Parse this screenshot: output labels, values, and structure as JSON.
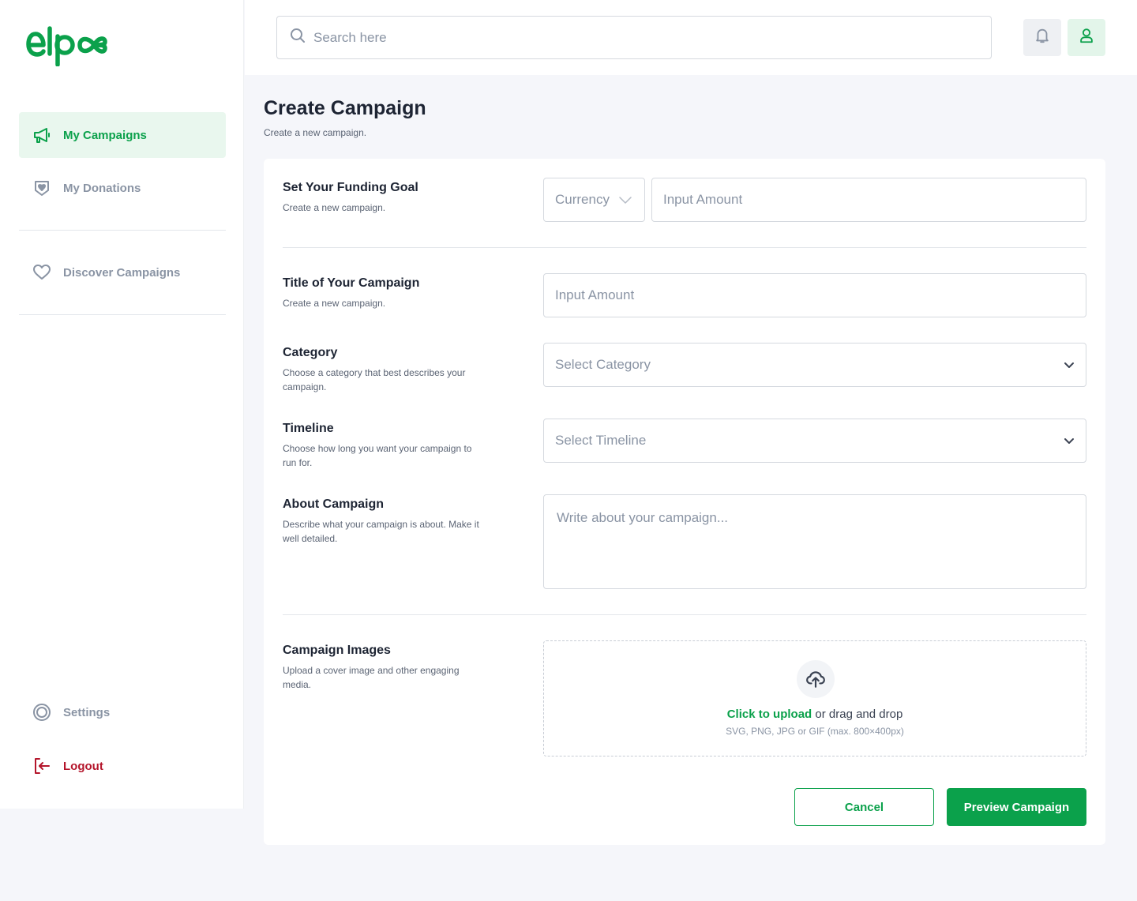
{
  "brand": {
    "logo_text": "elp",
    "accent": "#0BA14B",
    "danger": "#B4152B"
  },
  "header": {
    "search_placeholder": "Search here",
    "icons": [
      "search-icon",
      "bell-icon",
      "user-icon"
    ]
  },
  "sidebar": {
    "items": [
      {
        "label": "My Campaigns",
        "icon": "megaphone-icon",
        "active": true
      },
      {
        "label": "My Donations",
        "icon": "donation-icon",
        "active": false
      },
      {
        "label": "Discover Campaigns",
        "icon": "heart-icon",
        "active": false
      }
    ],
    "settings_label": "Settings",
    "logout_label": "Logout"
  },
  "page": {
    "title": "Create Campaign",
    "subtitle": "Create a new campaign."
  },
  "form": {
    "funding": {
      "label": "Set Your Funding Goal",
      "desc": "Create a new campaign.",
      "currency_placeholder": "Currency",
      "amount_placeholder": "Input Amount"
    },
    "title": {
      "label": "Title of Your Campaign",
      "desc": "Create a new campaign.",
      "placeholder": "Input Amount"
    },
    "category": {
      "label": "Category",
      "desc": "Choose a category that best describes your campaign.",
      "placeholder": "Select Category"
    },
    "timeline": {
      "label": "Timeline",
      "desc": "Choose how long you want your campaign to run for.",
      "placeholder": "Select Timeline"
    },
    "about": {
      "label": "About Campaign",
      "desc": "Describe what your campaign is about. Make it well detailed.",
      "placeholder": "Write about your campaign..."
    },
    "images": {
      "label": "Campaign Images",
      "desc": "Upload a cover image and other engaging media.",
      "upload_link": "Click to upload",
      "upload_rest": " or drag and drop",
      "hint": "SVG, PNG, JPG or GIF (max. 800×400px)"
    },
    "cancel_label": "Cancel",
    "preview_label": "Preview Campaign"
  }
}
